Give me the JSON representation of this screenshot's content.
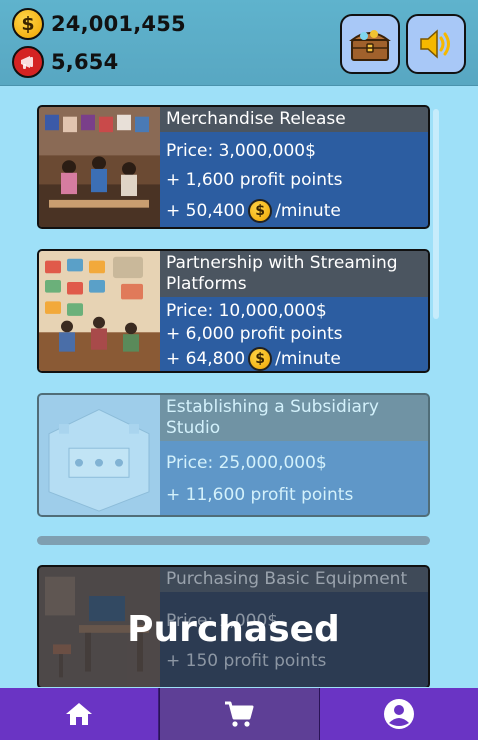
{
  "header": {
    "coins": "24,001,455",
    "fans": "5,654",
    "coin_symbol": "$",
    "coin_icon": "dollar-coin-icon",
    "fans_icon": "megaphone-icon",
    "chest_icon": "treasure-chest-icon",
    "sound_icon": "speaker-icon"
  },
  "upgrades": [
    {
      "title": "Merchandise Release",
      "price": "Price: 3,000,000$",
      "profit": "+ 1,600 profit points",
      "income_value": "+ 50,400",
      "income_unit": "/minute",
      "status": "available"
    },
    {
      "title": "Partnership with Streaming Platforms",
      "price": "Price: 10,000,000$",
      "profit": "+ 6,000 profit points",
      "income_value": "+ 64,800",
      "income_unit": "/minute",
      "status": "available"
    },
    {
      "title": "Establishing a Subsidiary Studio",
      "price": "Price: 25,000,000$",
      "profit": "+ 11,600 profit points",
      "status": "locked"
    },
    {
      "title": "Purchasing Basic Equipment",
      "price": "Price: 1,000$",
      "profit": "+ 150 profit points",
      "status": "purchased",
      "overlay": "Purchased"
    }
  ],
  "nav": {
    "items": [
      {
        "name": "home",
        "icon": "home-icon"
      },
      {
        "name": "shop",
        "icon": "cart-icon",
        "active": true
      },
      {
        "name": "profile",
        "icon": "profile-icon"
      }
    ]
  },
  "colors": {
    "header_bg": "#5fb3cd",
    "body_bg": "#9ee0f8",
    "card_bg": "#2c5da1",
    "nav_bg": "#6a34c4",
    "coin": "#f5b800"
  }
}
